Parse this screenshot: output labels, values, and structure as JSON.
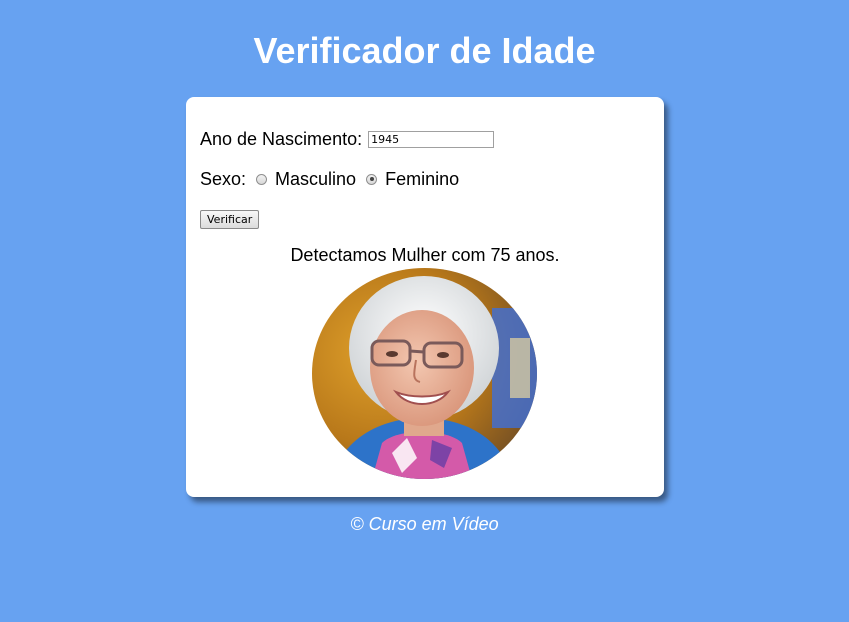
{
  "header": {
    "title": "Verificador de Idade"
  },
  "form": {
    "year_label": "Ano de Nascimento:",
    "year_value": "1945",
    "sex_label": "Sexo:",
    "option_male": "Masculino",
    "option_female": "Feminino",
    "selected_sex": "Feminino",
    "submit_label": "Verificar"
  },
  "result": {
    "message": "Detectamos Mulher com 75 anos.",
    "image_icon": "elderly-woman-photo"
  },
  "footer": {
    "text": "© Curso em Vídeo"
  },
  "colors": {
    "background": "#67a2f1",
    "card": "#ffffff",
    "title": "#ffffff"
  }
}
